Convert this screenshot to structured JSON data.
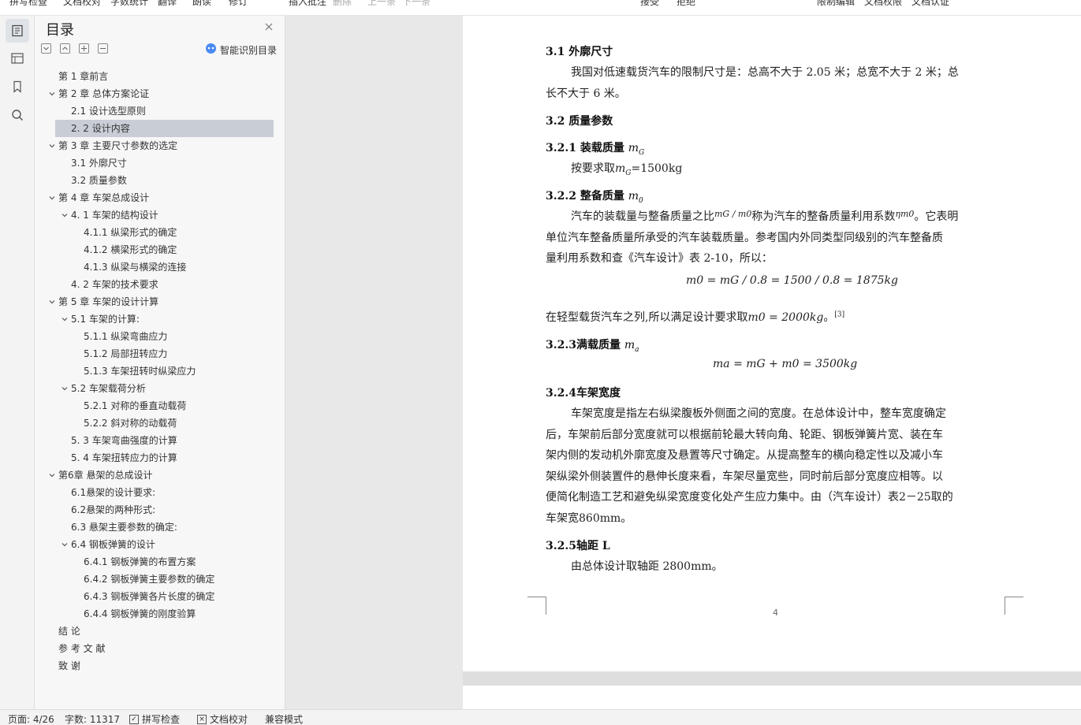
{
  "toolbar": {
    "items": [
      "拼写检查",
      "文档校对",
      "字数统计",
      "翻译",
      "朗读",
      "修订",
      "插入批注",
      "删除",
      "上一条",
      "下一条",
      "接受",
      "拒绝",
      "限制编辑",
      "文档权限",
      "文档认证"
    ]
  },
  "rail": {
    "icons": [
      "toc-icon",
      "outline-icon",
      "bookmark-icon",
      "search-icon"
    ]
  },
  "toc": {
    "title": "目录",
    "smart_label": "智能识别目录",
    "items": [
      {
        "label": "第 1 章前言",
        "level": 1,
        "toggle": false
      },
      {
        "label": "第 2 章  总体方案论证",
        "level": 1,
        "toggle": true
      },
      {
        "label": "2.1  设计选型原则",
        "level": 2,
        "toggle": false
      },
      {
        "label": "2.  2  设计内容",
        "level": 2,
        "toggle": false,
        "selected": true
      },
      {
        "label": "第 3 章  主要尺寸参数的选定",
        "level": 1,
        "toggle": true
      },
      {
        "label": "3.1  外廓尺寸",
        "level": 2,
        "toggle": false
      },
      {
        "label": "3.2  质量参数",
        "level": 2,
        "toggle": false
      },
      {
        "label": "第 4 章   车架总成设计",
        "level": 1,
        "toggle": true
      },
      {
        "label": "4.  1  车架的结构设计",
        "level": 2,
        "toggle": true
      },
      {
        "label": "4.1.1  纵梁形式的确定",
        "level": 3,
        "toggle": false
      },
      {
        "label": "4.1.2  横梁形式的确定",
        "level": 3,
        "toggle": false
      },
      {
        "label": "4.1.3  纵梁与横梁的连接",
        "level": 3,
        "toggle": false
      },
      {
        "label": "4.  2  车架的技术要求",
        "level": 2,
        "toggle": false
      },
      {
        "label": "第 5 章  车架的设计计算",
        "level": 1,
        "toggle": true
      },
      {
        "label": "5.1  车架的计算:",
        "level": 2,
        "toggle": true
      },
      {
        "label": "5.1.1  纵梁弯曲应力",
        "level": 3,
        "toggle": false
      },
      {
        "label": "5.1.2 局部扭转应力",
        "level": 3,
        "toggle": false
      },
      {
        "label": "5.1.3  车架扭转时纵梁应力",
        "level": 3,
        "toggle": false
      },
      {
        "label": "5.2  车架载荷分析",
        "level": 2,
        "toggle": true
      },
      {
        "label": "5.2.1  对称的垂直动载荷",
        "level": 3,
        "toggle": false
      },
      {
        "label": "5.2.2  斜对称的动载荷",
        "level": 3,
        "toggle": false
      },
      {
        "label": "5.  3  车架弯曲强度的计算",
        "level": 2,
        "toggle": false
      },
      {
        "label": "5.  4  车架扭转应力的计算",
        "level": 2,
        "toggle": false
      },
      {
        "label": "第6章  悬架的总成设计",
        "level": 1,
        "toggle": true
      },
      {
        "label": "6.1悬架的设计要求:",
        "level": 2,
        "toggle": false
      },
      {
        "label": "6.2悬架的两种形式:",
        "level": 2,
        "toggle": false
      },
      {
        "label": "6.3 悬架主要参数的确定:",
        "level": 2,
        "toggle": false
      },
      {
        "label": "6.4 钢板弹簧的设计",
        "level": 2,
        "toggle": true
      },
      {
        "label": "6.4.1 钢板弹簧的布置方案",
        "level": 3,
        "toggle": false
      },
      {
        "label": "6.4.2  钢板弹簧主要参数的确定",
        "level": 3,
        "toggle": false
      },
      {
        "label": "6.4.3  钢板弹簧各片长度的确定",
        "level": 3,
        "toggle": false
      },
      {
        "label": "6.4.4  钢板弹簧的刚度验算",
        "level": 3,
        "toggle": false
      },
      {
        "label": "结  论",
        "level": 1,
        "toggle": false
      },
      {
        "label": "参  考  文  献",
        "level": 1,
        "toggle": false
      },
      {
        "label": "致      谢",
        "level": 1,
        "toggle": false
      }
    ]
  },
  "doc": {
    "h_3_1": "3.1  外廓尺寸",
    "p_3_1_a": "我国对低速载货汽车的限制尺寸是：总高不大于 2.05 米；总宽不大于 2 米；总",
    "p_3_1_b": "长不大于 6 米。",
    "h_3_2": "3.2  质量参数",
    "h_3_2_1": "3.2.1 装载质量",
    "h_3_2_1_sym": "m",
    "h_3_2_1_sub": "G",
    "p_3_2_1_pre": "按要求取",
    "p_3_2_1_sym": "m",
    "p_3_2_1_sub": "G",
    "p_3_2_1_post": "=1500kg",
    "h_3_2_2": "3.2.2 整备质量",
    "h_3_2_2_sym": "m",
    "h_3_2_2_sub": "0",
    "p_3_2_2_l1_a": "汽车的装载量与整备质量之比",
    "p_3_2_2_l1_frac": "mG / m0",
    "p_3_2_2_l1_b": "称为汽车的整备质量利用系数",
    "p_3_2_2_l1_eta": "ηm0",
    "p_3_2_2_l1_c": "。它表明",
    "p_3_2_2_l2": "单位汽车整备质量所承受的汽车装载质量。参考国内外同类型同级别的汽车整备质",
    "p_3_2_2_l3": "量利用系数和查《汽车设计》表 2-10，所以：",
    "eq1": "m0 = mG / 0.8 = 1500 / 0.8 = 1875kg",
    "p_after_eq1_a": "在轻型载货汽车之列,所以满足设计要求取",
    "p_after_eq1_math": "m0 = 2000kg",
    "p_after_eq1_b": "。",
    "p_after_eq1_ref": "[3]",
    "h_3_2_3": "3.2.3满载质量",
    "h_3_2_3_sym": "m",
    "h_3_2_3_sub": "a",
    "eq2": "ma = mG + m0 = 3500kg",
    "h_3_2_4": "3.2.4车架宽度",
    "p_3_2_4": [
      "车架宽度是指左右纵梁腹板外侧面之间的宽度。在总体设计中，整车宽度确定",
      "后，车架前后部分宽度就可以根据前轮最大转向角、轮距、钢板弹簧片宽、装在车",
      "架内侧的发动机外廓宽度及悬置等尺寸确定。从提高整车的横向稳定性以及减小车",
      "架纵梁外侧装置件的悬伸长度来看，车架尽量宽些，同时前后部分宽度应相等。以",
      "便简化制造工艺和避免纵梁宽度变化处产生应力集中。由（汽车设计）表2－25取的",
      "车架宽860mm。"
    ],
    "h_3_2_5": "3.2.5轴距 L",
    "p_3_2_5": "由总体设计取轴距 2800mm。",
    "page_number": "4"
  },
  "status": {
    "page": "页面: 4/26",
    "words": "字数: 11317",
    "spell": "拼写检查",
    "proof": "文档校对",
    "compat": "兼容模式"
  }
}
